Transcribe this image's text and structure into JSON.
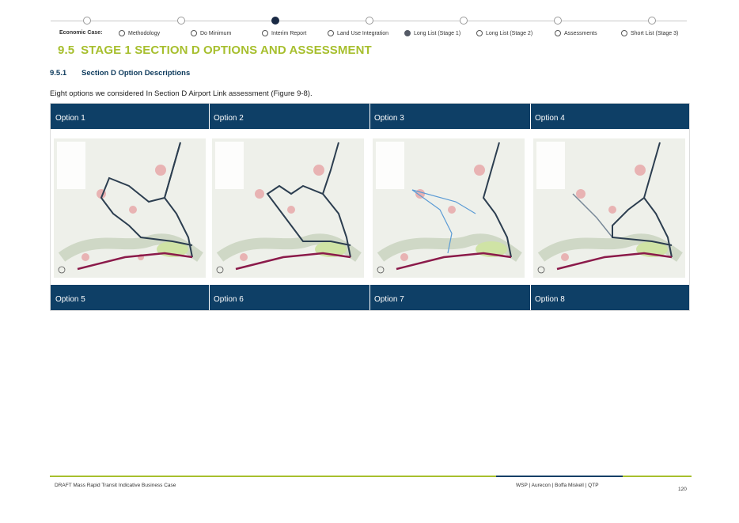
{
  "nav": {
    "label": "Economic Case:",
    "items": [
      {
        "label": "Methodology",
        "active": false
      },
      {
        "label": "Do Minimum",
        "active": false
      },
      {
        "label": "Interim Report",
        "active": false
      },
      {
        "label": "Land Use Integration",
        "active": false
      },
      {
        "label": "Long List (Stage 1)",
        "active": true
      },
      {
        "label": "Long List (Stage 2)",
        "active": false
      },
      {
        "label": "Assessments",
        "active": false
      },
      {
        "label": "Short List (Stage 3)",
        "active": false
      }
    ]
  },
  "heading": {
    "number": "9.5",
    "title": "STAGE 1 SECTION D OPTIONS AND ASSESSMENT"
  },
  "subheading": {
    "number": "9.5.1",
    "title": "Section D Option Descriptions"
  },
  "paragraph": "Eight options we considered In Section D Airport Link assessment (Figure 9-8).",
  "table": {
    "top_row": [
      "Option 1",
      "Option 2",
      "Option 3",
      "Option 4"
    ],
    "bottom_row": [
      "Option 5",
      "Option 6",
      "Option 7",
      "Option 8"
    ]
  },
  "footer": {
    "left": "DRAFT Mass Rapid Transit Indicative Business Case",
    "right": "WSP | Aurecon | Boffa Miskell | QTP",
    "page": "120"
  },
  "colors": {
    "accent": "#a7bf2e",
    "navy": "#0e3f66"
  }
}
